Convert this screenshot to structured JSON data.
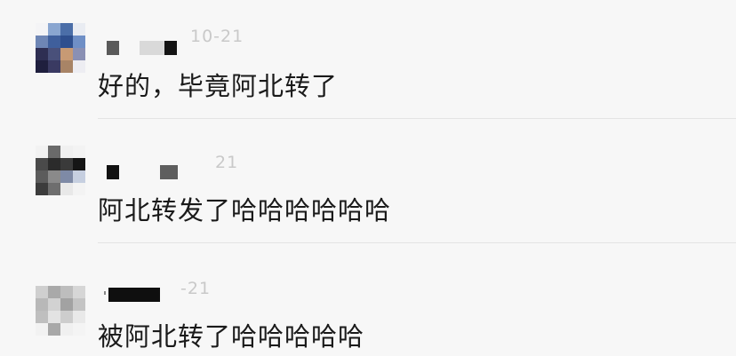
{
  "comments": [
    {
      "time": "10-21",
      "text": "好的，毕竟阿北转了"
    },
    {
      "time": "21",
      "text": "阿北转发了哈哈哈哈哈哈"
    },
    {
      "time": "-21",
      "text": "被阿北转了哈哈哈哈哈"
    }
  ]
}
